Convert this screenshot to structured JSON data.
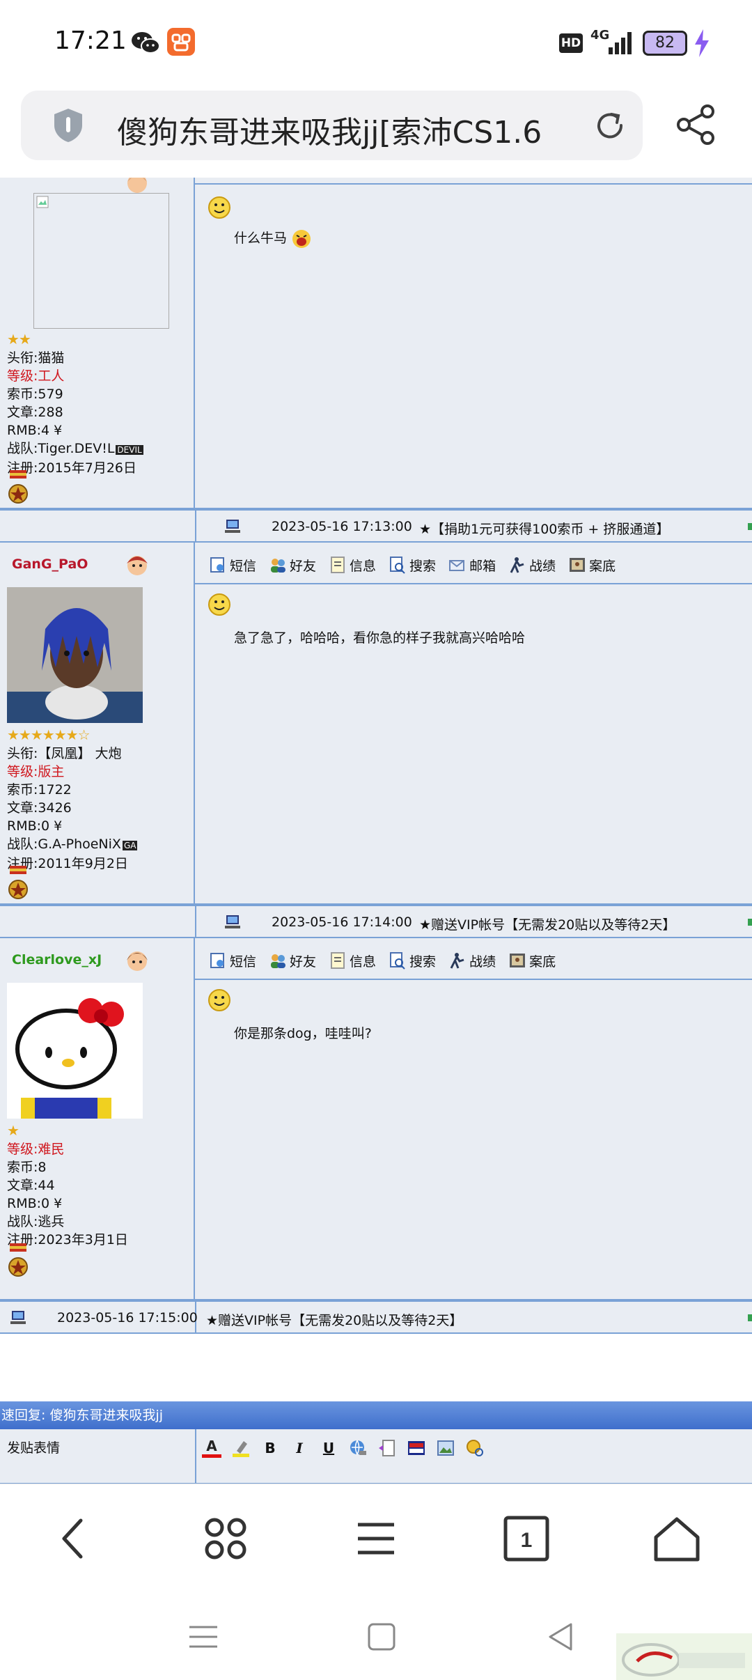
{
  "status_bar": {
    "time": "17:21",
    "hd": "HD",
    "network": "4G",
    "battery": "82"
  },
  "browser": {
    "page_title": "傻狗东哥进来吸我jj[索沛CS1.6"
  },
  "posts": [
    {
      "message": "什么牛马",
      "stars": "★★",
      "info": {
        "title_label": "头衔:",
        "title": "猫猫",
        "level_label": "等级:",
        "level": "工人",
        "coins_label": "索币:",
        "coins": "579",
        "articles_label": "文章:",
        "articles": "288",
        "rmb_label": "RMB:",
        "rmb": "4 ¥",
        "team_label": "战队:",
        "team": "Tiger.DEV!L",
        "team_badge": "DEVIL",
        "reg_label": "注册:",
        "reg": "2015年7月26日"
      },
      "footer_time": "2023-05-16 17:13:00",
      "footer_note": "★【捐助1元可获得100索币 + 挤服通道】"
    },
    {
      "username": "GanG_PaO",
      "message": "急了急了，哈哈哈，看你急的样子我就高兴哈哈哈",
      "stars": "★★★★★★☆",
      "toolbar": [
        "短信",
        "好友",
        "信息",
        "搜索",
        "邮箱",
        "战绩",
        "案底"
      ],
      "info": {
        "title_label": "头衔:",
        "title": "【凤凰】 大炮",
        "level_label": "等级:",
        "level": "版主",
        "coins_label": "索币:",
        "coins": "1722",
        "articles_label": "文章:",
        "articles": "3426",
        "rmb_label": "RMB:",
        "rmb": "0 ¥",
        "team_label": "战队:",
        "team": "G.A-PhoeNiX",
        "team_badge": "GA",
        "reg_label": "注册:",
        "reg": "2011年9月2日"
      },
      "footer_time": "2023-05-16 17:14:00",
      "footer_note": "★赠送VIP帐号【无需发20贴以及等待2天】"
    },
    {
      "username": "Clearlove_xJ",
      "message": "你是那条dog，哇哇叫?",
      "stars": "★",
      "toolbar": [
        "短信",
        "好友",
        "信息",
        "搜索",
        "战绩",
        "案底"
      ],
      "info": {
        "level_label": "等级:",
        "level": "难民",
        "coins_label": "索币:",
        "coins": "8",
        "articles_label": "文章:",
        "articles": "44",
        "rmb_label": "RMB:",
        "rmb": "0 ¥",
        "team_label": "战队:",
        "team": "逃兵",
        "reg_label": "注册:",
        "reg": "2023年3月1日"
      },
      "footer_time": "2023-05-16 17:15:00",
      "footer_note": "★赠送VIP帐号【无需发20贴以及等待2天】"
    }
  ],
  "quick_reply": {
    "title": "速回复: 傻狗东哥进来吸我jj",
    "emoticons_label": "发贴表情",
    "bold": "B",
    "italic": "I",
    "underline": "U",
    "font_color": "A"
  },
  "colors": {
    "border": "#7aa2d6",
    "panel": "#e9edf3",
    "level_red": "#d0181f",
    "name_red": "#b8172b",
    "name_green": "#2e9a1e",
    "reply_bar": "#4a78d2"
  }
}
